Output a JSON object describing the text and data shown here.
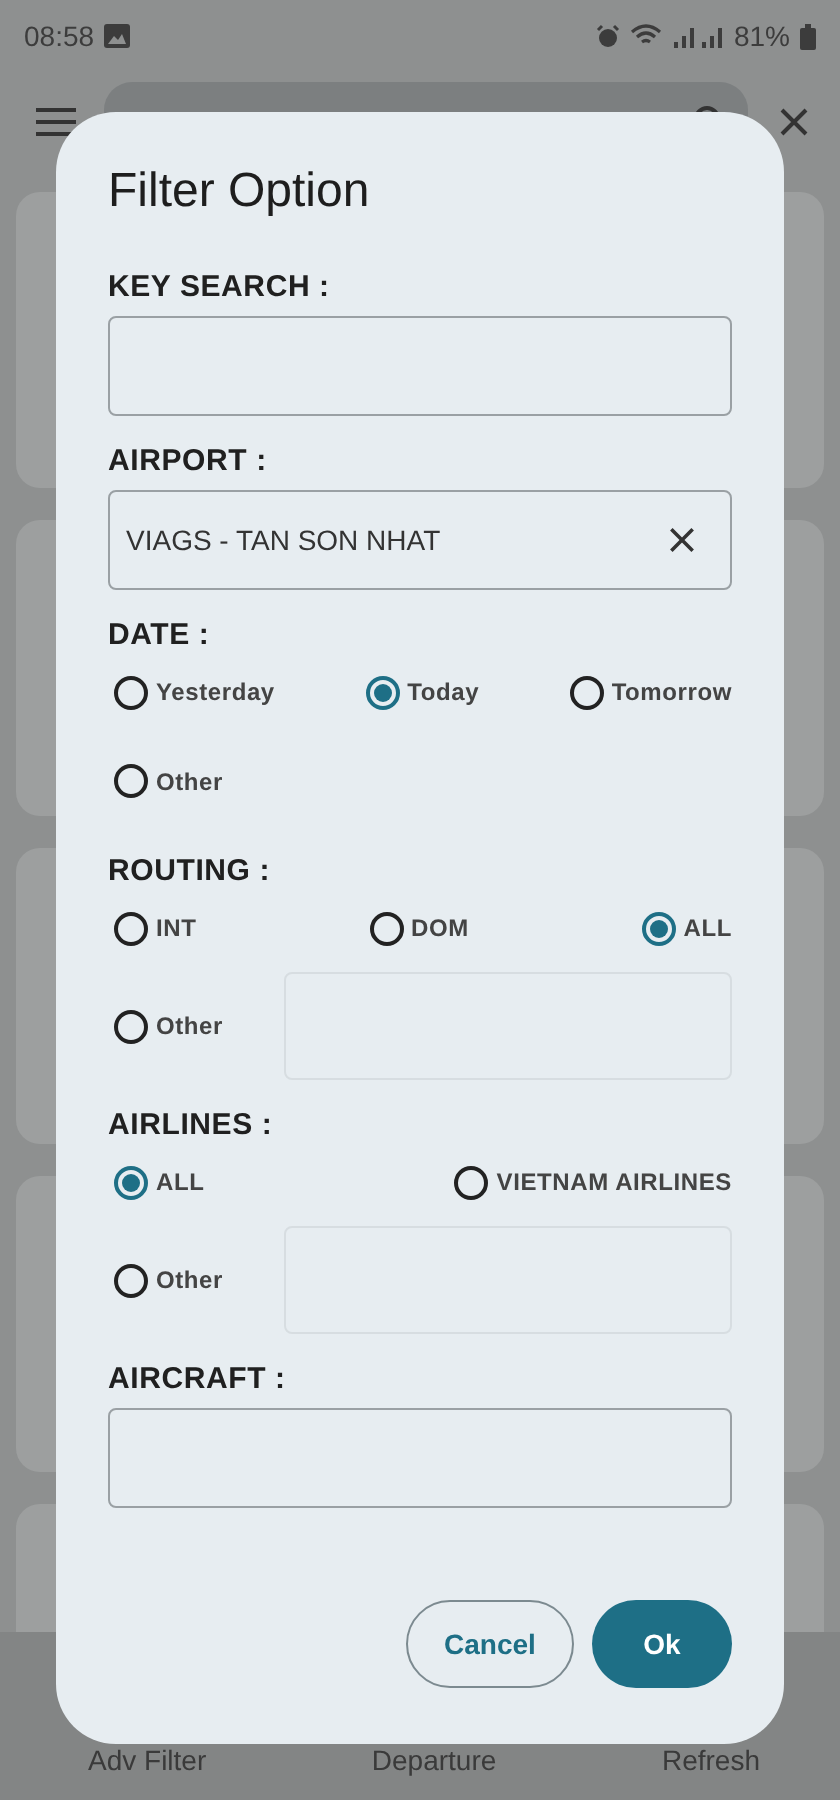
{
  "status_bar": {
    "time": "08:58",
    "battery": "81%"
  },
  "bottom_nav": {
    "items": [
      "Adv Filter",
      "Departure",
      "Refresh"
    ]
  },
  "dialog": {
    "title": "Filter Option",
    "sections": [
      {
        "kind": "field",
        "label": "KEY SEARCH :",
        "clearable": false
      },
      {
        "kind": "field",
        "label": "AIRPORT :",
        "value": "VIAGS - TAN SON NHAT",
        "clearable": true
      },
      {
        "kind": "radio",
        "label": "DATE :",
        "other_field": false,
        "options": [
          {
            "label": "Yesterday",
            "selected": false
          },
          {
            "label": "Today",
            "selected": true
          },
          {
            "label": "Tomorrow",
            "selected": false
          }
        ],
        "other": {
          "label": "Other",
          "selected": false
        }
      },
      {
        "kind": "radio",
        "label": "ROUTING :",
        "other_field": true,
        "options": [
          {
            "label": "INT",
            "selected": false
          },
          {
            "label": "DOM",
            "selected": false
          },
          {
            "label": "ALL",
            "selected": true
          }
        ],
        "other": {
          "label": "Other",
          "selected": false
        }
      },
      {
        "kind": "radio",
        "label": "AIRLINES :",
        "other_field": true,
        "options": [
          {
            "label": "ALL",
            "selected": true
          },
          {
            "label": "VIETNAM AIRLINES",
            "selected": false
          }
        ],
        "other": {
          "label": "Other",
          "selected": false
        }
      },
      {
        "kind": "field",
        "label": "AIRCRAFT :",
        "clearable": false
      }
    ],
    "buttons": [
      {
        "label": "Cancel",
        "kind": "outline"
      },
      {
        "label": "Ok",
        "kind": "primary"
      }
    ]
  }
}
